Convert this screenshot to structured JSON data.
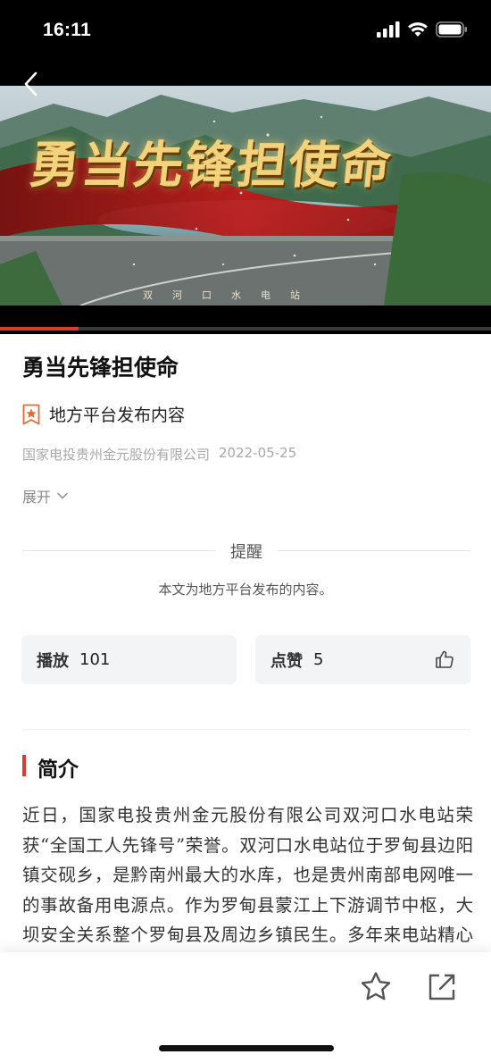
{
  "status_bar": {
    "time": "16:11"
  },
  "video": {
    "overlay_title": "勇当先锋担使命",
    "dam_sign": "双河口水电站",
    "progress_fraction": 0.16
  },
  "article": {
    "title": "勇当先锋担使命",
    "source_label": "地方平台发布内容",
    "publisher": "国家电投贵州金元股份有限公司",
    "date": "2022-05-25",
    "expand_label": "展开"
  },
  "notice": {
    "title": "提醒",
    "text": "本文为地方平台发布的内容。"
  },
  "stats": {
    "plays_label": "播放",
    "plays_value": "101",
    "likes_label": "点赞",
    "likes_value": "5"
  },
  "intro": {
    "heading": "简介",
    "text": "近日，国家电投贵州金元股份有限公司双河口水电站荣获“全国工人先锋号”荣誉。双河口水电站位于罗甸县边阳镇交砚乡，是黔南州最大的水库，也是贵州南部电网唯一的事故备用电源点。作为罗甸县蒙江上下游调节中枢，大坝安全关系整个罗甸县及周边乡镇民生。多年来电站精心操作维护，实现了流域安全度汛，确保了下"
  },
  "icons": {
    "back": "back-arrow-icon",
    "source": "star-badge-icon",
    "expand": "chevron-down-icon",
    "like": "thumbs-up-icon",
    "favorite": "star-outline-icon",
    "share": "share-icon"
  },
  "colors": {
    "accent": "#e03a2f",
    "card_bg": "#f3f4f6",
    "muted": "#a8a8a8"
  }
}
